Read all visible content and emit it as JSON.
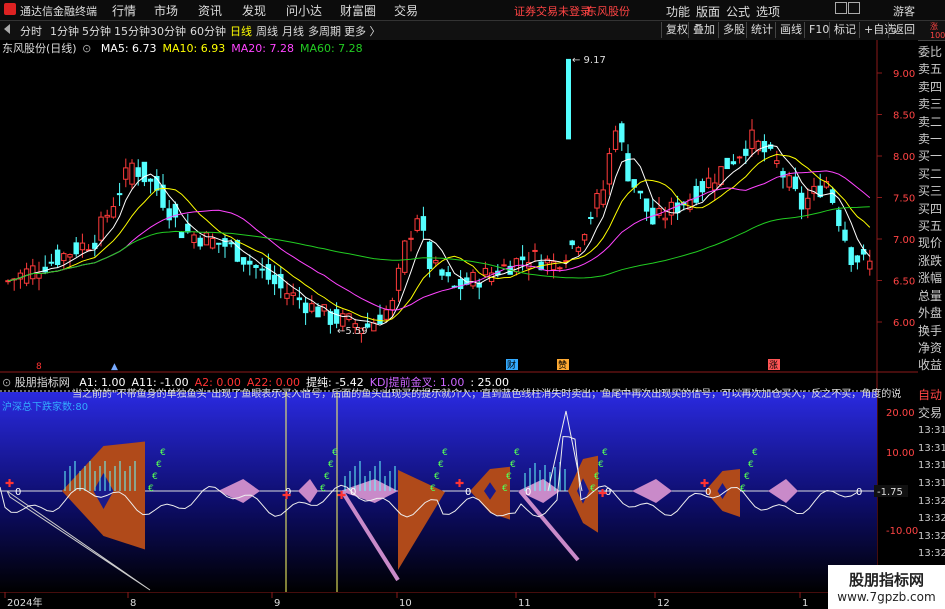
{
  "app": {
    "title": "通达信金融终端"
  },
  "menu": [
    "行情",
    "市场",
    "资讯",
    "发现",
    "问小达",
    "财富圈",
    "交易"
  ],
  "notice": "证券交易未登录",
  "stock_name_header": "东风股份",
  "top_right": [
    "功能",
    "版面",
    "公式",
    "选项",
    "画线"
  ],
  "user": "游客",
  "periods": [
    "分时",
    "1分钟",
    "5分钟",
    "15分钟",
    "30分钟",
    "60分钟",
    "日线",
    "周线",
    "月线",
    "多周期",
    "更多"
  ],
  "active_period": "日线",
  "tool_buttons": [
    "复权",
    "叠加",
    "多股",
    "统计",
    "画线",
    "F10",
    "标记",
    "+自选",
    "返回"
  ],
  "main_chart": {
    "title": "东风股份(日线)",
    "ma": [
      {
        "label": "MA5:",
        "value": "6.73",
        "color": "#ffffff"
      },
      {
        "label": "MA10:",
        "value": "6.93",
        "color": "#ffff00"
      },
      {
        "label": "MA20:",
        "value": "7.28",
        "color": "#ff44ff"
      },
      {
        "label": "MA60:",
        "value": "7.28",
        "color": "#22cc22"
      }
    ],
    "price_axis": [
      "9.00",
      "8.50",
      "8.00",
      "7.50",
      "7.00",
      "6.50",
      "6.00"
    ],
    "high_label": "9.17",
    "low_label": "5.59",
    "event_markers": [
      "财",
      "赞",
      "涨"
    ]
  },
  "side_panel": {
    "top_labels": [
      "委比",
      "卖五",
      "卖四",
      "卖三",
      "卖二",
      "卖一",
      "买一",
      "买二",
      "买三",
      "买四",
      "买五",
      "现价",
      "涨跌",
      "涨幅",
      "总量",
      "外盘",
      "换手",
      "净资",
      "收益"
    ],
    "corner": "涨\n1000",
    "bottom_labels": [
      "自动",
      "交易",
      "13:31",
      "13:31",
      "13:31",
      "13:31",
      "13:32",
      "13:32",
      "13:32",
      "13:32",
      "13:32",
      "13:32"
    ]
  },
  "indicator": {
    "name": "股朋指标网",
    "params": [
      {
        "label": "A1:",
        "value": "1.00",
        "color": "#ffffff"
      },
      {
        "label": "A11:",
        "value": "-1.00",
        "color": "#ffffff"
      },
      {
        "label": "A2:",
        "value": "0.00",
        "color": "#ff3333"
      },
      {
        "label": "A22:",
        "value": "0.00",
        "color": "#ff3333"
      },
      {
        "label": "提纯:",
        "value": "-5.42",
        "color": "#ffffff"
      },
      {
        "label": "KDJ提前金叉:",
        "value": "1.00",
        "color": "#cc66ff"
      },
      {
        "label": ":",
        "value": "25.00",
        "color": "#ffffff"
      }
    ],
    "banner_text": "当之前的\"不带鱼身的单独鱼头\"出现了鱼眼表示买入信号，后面的鱼头出现买的提示就介入；直到蓝色线柱消失时卖出；鱼尾中再次出现买的信号，可以再次加仓买入；反之不买，角度的说",
    "sub_text": "沪深总下跌家数:80",
    "axis": [
      "20.00",
      "10.00",
      "-1.75",
      "-10.00"
    ],
    "current_value": "-1.75"
  },
  "date_axis": [
    "2024年",
    "8",
    "9",
    "10",
    "11",
    "12",
    "1"
  ],
  "watermark": {
    "title": "股朋指标网",
    "url": "www.7gpzb.com"
  }
}
